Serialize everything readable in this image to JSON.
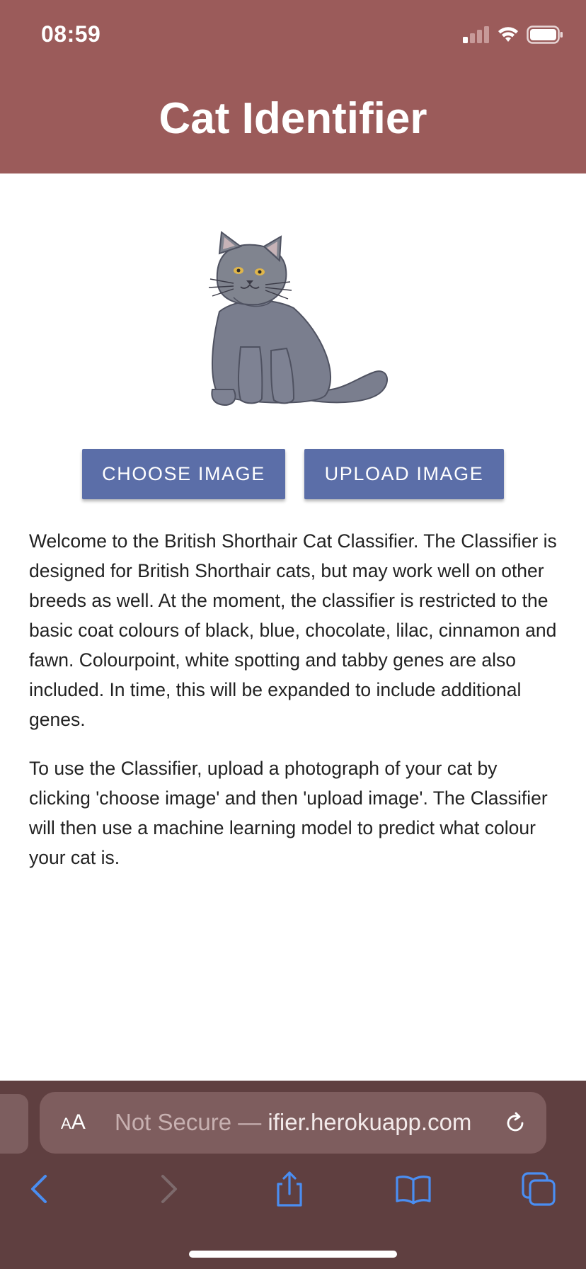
{
  "status_bar": {
    "time": "08:59",
    "icons": [
      "signal-icon",
      "wifi-icon",
      "battery-icon"
    ]
  },
  "header": {
    "title": "Cat Identifier",
    "background": "#9b5b5a"
  },
  "hero_image": {
    "icon": "british-shorthair-cat-illustration"
  },
  "buttons": {
    "choose_label": "CHOOSE IMAGE",
    "upload_label": "UPLOAD IMAGE",
    "color": "#5b6ea8"
  },
  "content": {
    "paragraph_1": "Welcome to the British Shorthair Cat Classifier. The Classifier is designed for British Shorthair cats, but may work well on other breeds as well. At the moment, the classifier is restricted to the basic coat colours of black, blue, chocolate, lilac, cinnamon and fawn. Colourpoint, white spotting and tabby genes are also included. In time, this will be expanded to include additional genes.",
    "paragraph_2": "To use the Classifier, upload a photograph of your cat by clicking 'choose image' and then 'upload image'. The Classifier will then use a machine learning model to predict what colour your cat is."
  },
  "browser": {
    "text_size_label_large": "A",
    "text_size_label_small": "A",
    "url_prefix": "Not Secure — ",
    "url_domain": "ifier.herokuapp.com",
    "toolbar_icons": [
      "back-icon",
      "forward-icon",
      "share-icon",
      "bookmarks-icon",
      "tabs-icon"
    ],
    "background": "#5f3f40"
  }
}
